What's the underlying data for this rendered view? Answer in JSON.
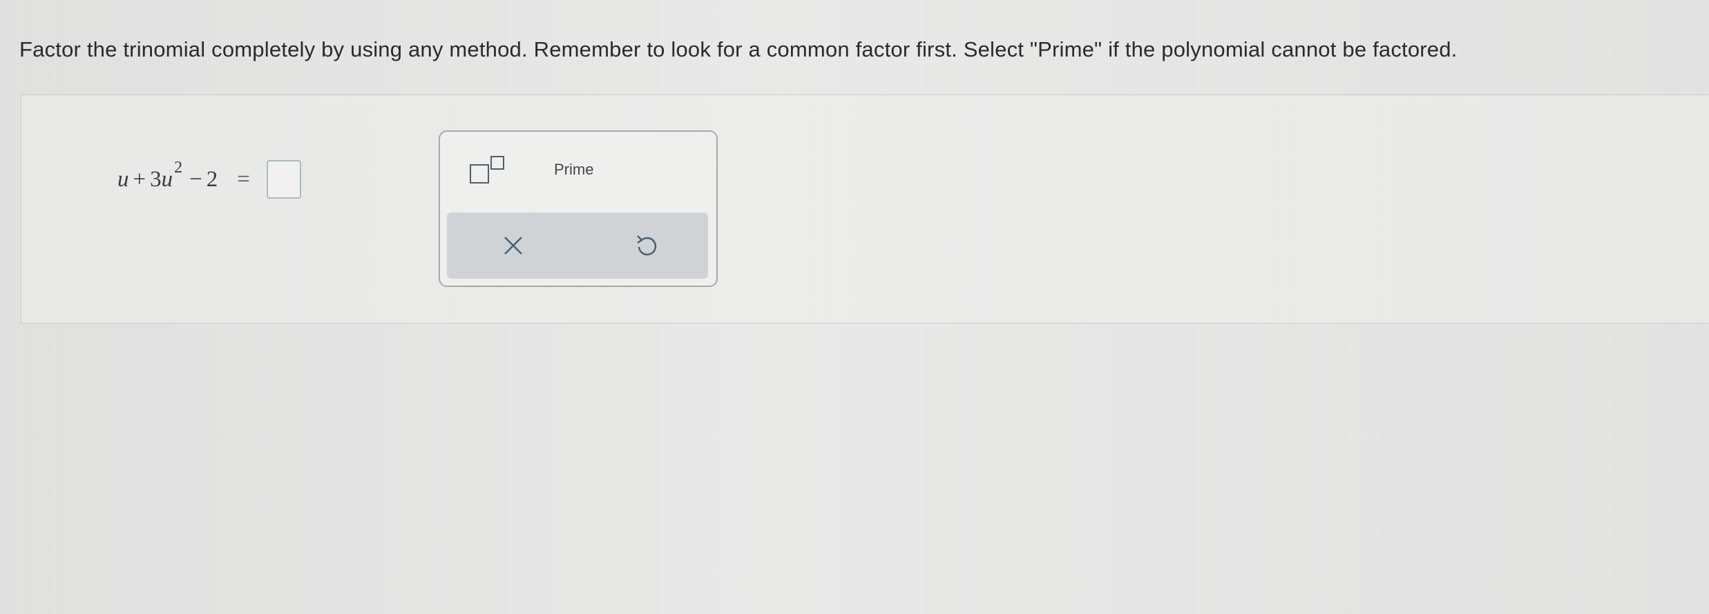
{
  "instructions": "Factor the trinomial completely by using any method. Remember to look for a common factor first. Select \"Prime\" if the polynomial cannot be factored.",
  "equation": {
    "var": "u",
    "plus": "+",
    "coef": "3",
    "exponent": "2",
    "minus": "−",
    "constant": "2",
    "equals": "="
  },
  "toolbar": {
    "exponent_icon": "superscript-template-icon",
    "prime_label": "Prime",
    "clear_icon": "close-icon",
    "undo_icon": "undo-icon"
  },
  "colors": {
    "action_bar": "#cfd3d6",
    "answer_box_border": "#a9bcc4",
    "icon": "#4a5e72"
  }
}
